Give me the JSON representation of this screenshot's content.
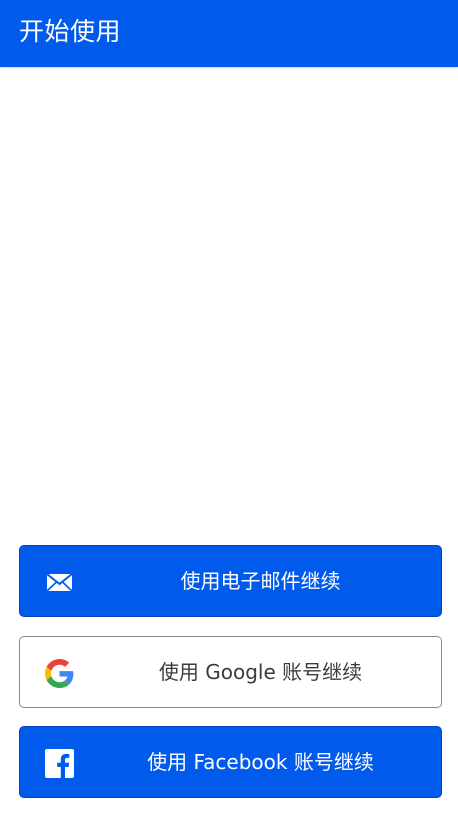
{
  "appbar": {
    "title": "开始使用",
    "color": "#005aeb"
  },
  "auth": {
    "email": {
      "label": "使用电子邮件继续",
      "icon": "envelope-icon"
    },
    "google": {
      "label": "使用 Google 账号继续",
      "icon": "google-icon"
    },
    "facebook": {
      "label": "使用 Facebook 账号继续",
      "icon": "facebook-icon"
    }
  },
  "colors": {
    "primary": "#005aeb",
    "outline_border": "#8a8a8a",
    "text_dark": "#3c3c3c",
    "text_light": "#ffffff"
  }
}
